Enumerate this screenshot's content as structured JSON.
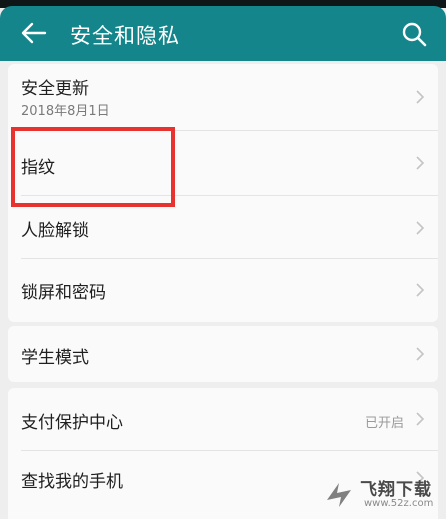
{
  "header": {
    "title": "安全和隐私",
    "back_icon": "back-arrow-icon",
    "search_icon": "search-icon"
  },
  "settings": [
    {
      "label": "安全更新",
      "sub": "2018年8月1日",
      "value": ""
    },
    {
      "label": "指纹",
      "sub": "",
      "value": ""
    },
    {
      "label": "人脸解锁",
      "sub": "",
      "value": ""
    },
    {
      "label": "锁屏和密码",
      "sub": "",
      "value": ""
    },
    {
      "label": "学生模式",
      "sub": "",
      "value": ""
    },
    {
      "label": "支付保护中心",
      "sub": "",
      "value": "已开启"
    },
    {
      "label": "查找我的手机",
      "sub": "",
      "value": ""
    }
  ],
  "watermark": {
    "text": "飞翔下载",
    "url": "www.52z.com"
  },
  "colors": {
    "appbar": "#14858a",
    "highlight": "#e8322f",
    "background": "#eeeeee"
  }
}
